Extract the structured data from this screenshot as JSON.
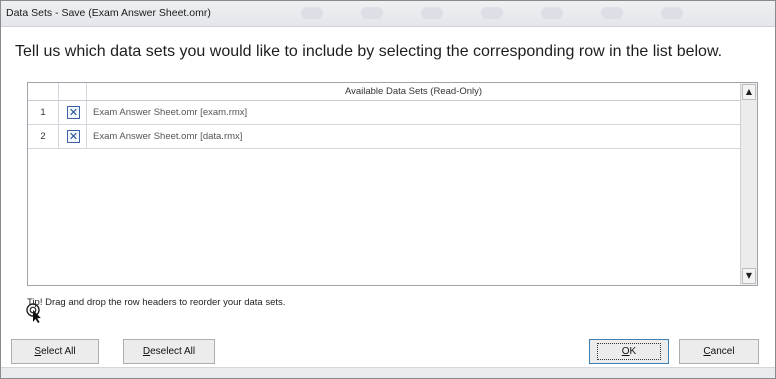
{
  "window": {
    "title": "Data Sets - Save (Exam Answer Sheet.omr)"
  },
  "instruction": "Tell us which data sets you would like to include by selecting the corresponding row in the list below.",
  "grid": {
    "column_header": "Available Data Sets (Read-Only)",
    "rows": [
      {
        "number": "1",
        "checked": true,
        "name": "Exam Answer Sheet.omr [exam.rmx]"
      },
      {
        "number": "2",
        "checked": true,
        "name": "Exam Answer Sheet.omr [data.rmx]"
      }
    ],
    "check_glyph": "✕"
  },
  "tip": {
    "icon": "tip-cursor-icon",
    "text": "Tip!  Drag and drop the row headers to reorder your data sets."
  },
  "buttons": {
    "select_all": {
      "mnemonic": "S",
      "rest": "elect All"
    },
    "deselect_all": {
      "mnemonic": "D",
      "rest": "eselect All"
    },
    "ok": {
      "mnemonic": "O",
      "rest": "K"
    },
    "cancel": {
      "mnemonic": "C",
      "rest": "ancel"
    }
  },
  "colors": {
    "checkbox_accent": "#1f4f9a",
    "focus_border": "#3c7fb1"
  }
}
